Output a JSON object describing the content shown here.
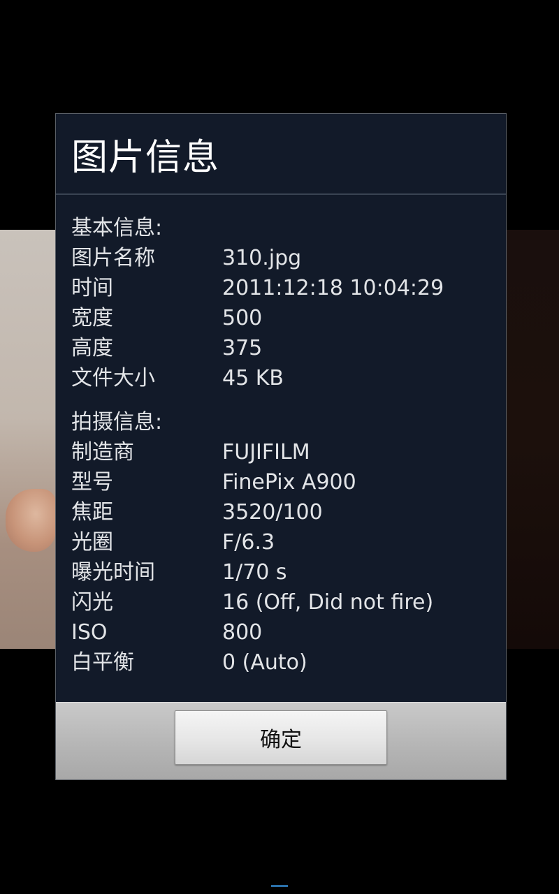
{
  "dialog": {
    "title": "图片信息",
    "ok_label": "确定"
  },
  "basic": {
    "heading": "基本信息:",
    "rows": [
      {
        "label": "图片名称",
        "value": "310.jpg"
      },
      {
        "label": "时间",
        "value": "2011:12:18 10:04:29"
      },
      {
        "label": "宽度",
        "value": "500"
      },
      {
        "label": "高度",
        "value": "375"
      },
      {
        "label": "文件大小",
        "value": "45 KB"
      }
    ]
  },
  "shooting": {
    "heading": "拍摄信息:",
    "rows": [
      {
        "label": "制造商",
        "value": "FUJIFILM"
      },
      {
        "label": "型号",
        "value": "FinePix A900"
      },
      {
        "label": "焦距",
        "value": "3520/100"
      },
      {
        "label": "光圈",
        "value": "F/6.3"
      },
      {
        "label": "曝光时间",
        "value": "1/70 s"
      },
      {
        "label": "闪光",
        "value": "16 (Off, Did not fire)"
      },
      {
        "label": "ISO",
        "value": "800"
      },
      {
        "label": "白平衡",
        "value": "0 (Auto)"
      }
    ]
  },
  "colors": {
    "dialog_bg": "#121a29",
    "footer_bg": "#b4b4b4",
    "text": "#e2e4e7"
  }
}
